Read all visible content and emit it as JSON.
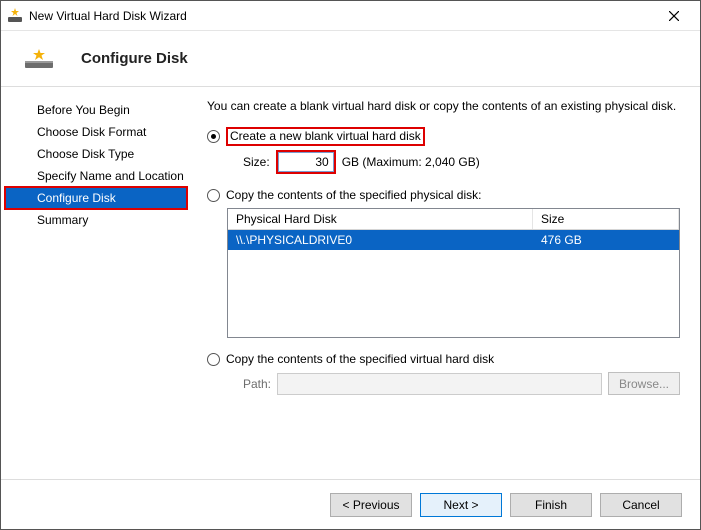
{
  "window": {
    "title": "New Virtual Hard Disk Wizard",
    "page_title": "Configure Disk"
  },
  "sidebar": {
    "steps": [
      "Before You Begin",
      "Choose Disk Format",
      "Choose Disk Type",
      "Specify Name and Location",
      "Configure Disk",
      "Summary"
    ],
    "active_index": 4
  },
  "main": {
    "description": "You can create a blank virtual hard disk or copy the contents of an existing physical disk.",
    "option_blank": {
      "label": "Create a new blank virtual hard disk",
      "checked": true
    },
    "size": {
      "label": "Size:",
      "value": "30",
      "unit_text": "GB (Maximum: 2,040 GB)"
    },
    "option_physical": {
      "label": "Copy the contents of the specified physical disk:",
      "checked": false
    },
    "grid": {
      "col1": "Physical Hard Disk",
      "col2": "Size",
      "rows": [
        {
          "disk": "\\\\.\\PHYSICALDRIVE0",
          "size": "476 GB"
        }
      ]
    },
    "option_virtual": {
      "label": "Copy the contents of the specified virtual hard disk",
      "checked": false
    },
    "path": {
      "label": "Path:",
      "value": "",
      "browse": "Browse..."
    }
  },
  "footer": {
    "previous": "< Previous",
    "next": "Next >",
    "finish": "Finish",
    "cancel": "Cancel"
  }
}
